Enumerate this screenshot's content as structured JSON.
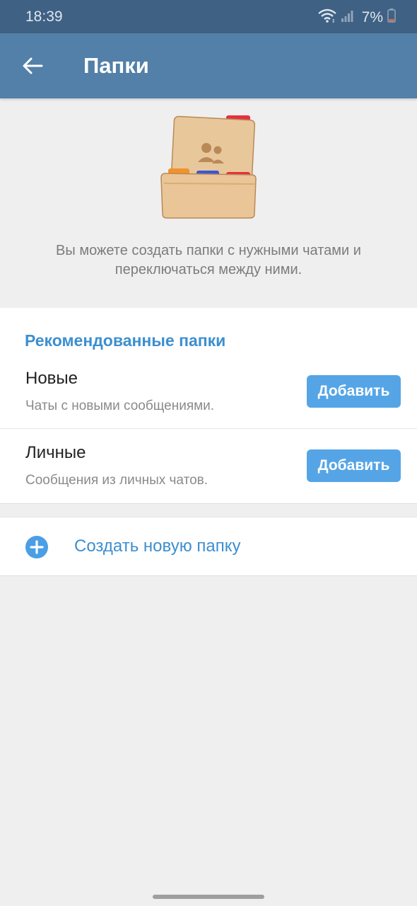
{
  "status_bar": {
    "time": "18:39",
    "battery_text": "7%",
    "icons": [
      "wifi-icon",
      "signal-icon",
      "battery-icon"
    ]
  },
  "app_bar": {
    "title": "Папки",
    "back_icon": "arrow-left-icon"
  },
  "hero": {
    "illustration": "folder-icon",
    "description": "Вы можете создать папки с нужными чатами и переключаться между ними."
  },
  "recommended": {
    "header": "Рекомендованные папки",
    "items": [
      {
        "title": "Новые",
        "subtitle": "Чаты с новыми сообщениями.",
        "button": "Добавить"
      },
      {
        "title": "Личные",
        "subtitle": "Сообщения из личных чатов.",
        "button": "Добавить"
      }
    ]
  },
  "create": {
    "label": "Создать новую папку",
    "icon": "plus-circle-icon"
  },
  "colors": {
    "status_bar": "#3f6184",
    "app_bar": "#5280a8",
    "accent": "#3d8fcf",
    "button": "#55a5e6",
    "background": "#efefef"
  }
}
